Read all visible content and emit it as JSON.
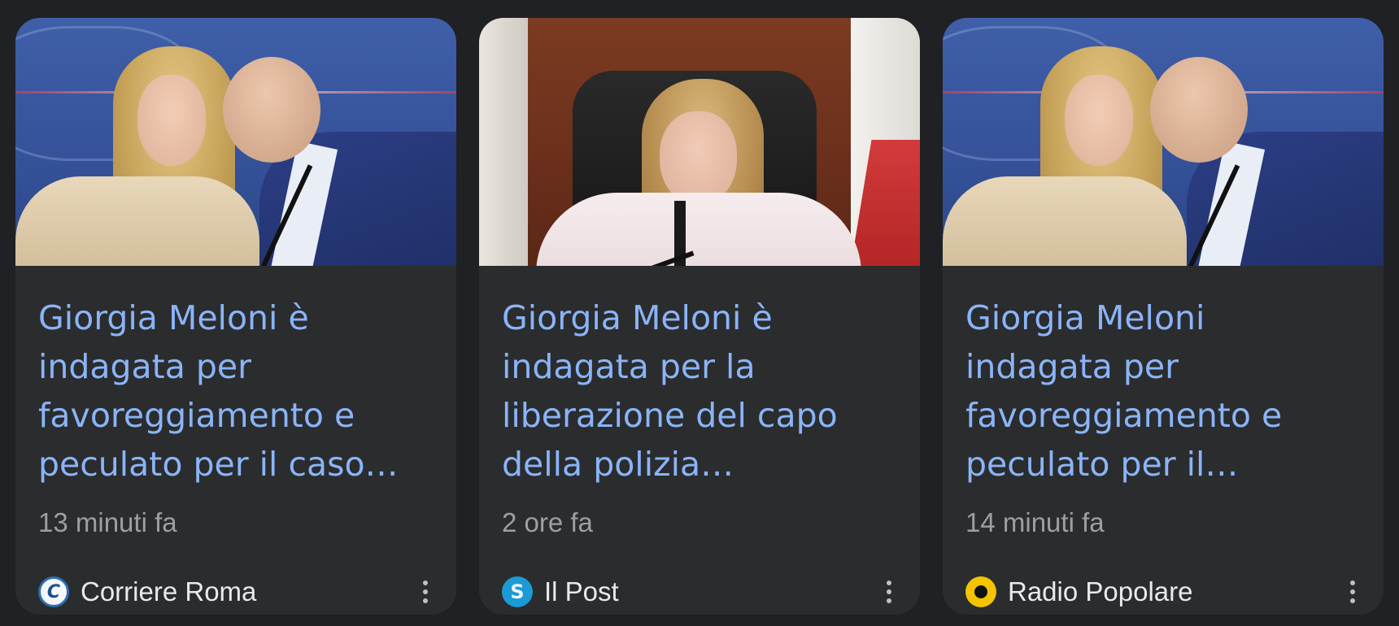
{
  "cards": [
    {
      "headline": "Giorgia Meloni è indagata per favoreggiamento e peculato per il caso…",
      "time": "13 minuti fa",
      "source": "Corriere Roma",
      "favicon_icon": "corriere-roma-logo",
      "favicon_color": "#2f6db5"
    },
    {
      "headline": "Giorgia Meloni è indagata per la liberazione del capo della polizia…",
      "time": "2 ore fa",
      "source": "Il Post",
      "favicon_icon": "il-post-logo",
      "favicon_color": "#1b9ad6"
    },
    {
      "headline": "Giorgia Meloni indagata per favoreggiamento e peculato per il…",
      "time": "14 minuti fa",
      "source": "Radio Popolare",
      "favicon_icon": "radio-popolare-logo",
      "favicon_color": "#f3c400"
    }
  ],
  "colors": {
    "background": "#202124",
    "card": "#2b2c2e",
    "headline": "#8ab4f8",
    "meta": "#9aa0a6",
    "source": "#e8eaed"
  },
  "menu_icon": "more-vert-icon"
}
